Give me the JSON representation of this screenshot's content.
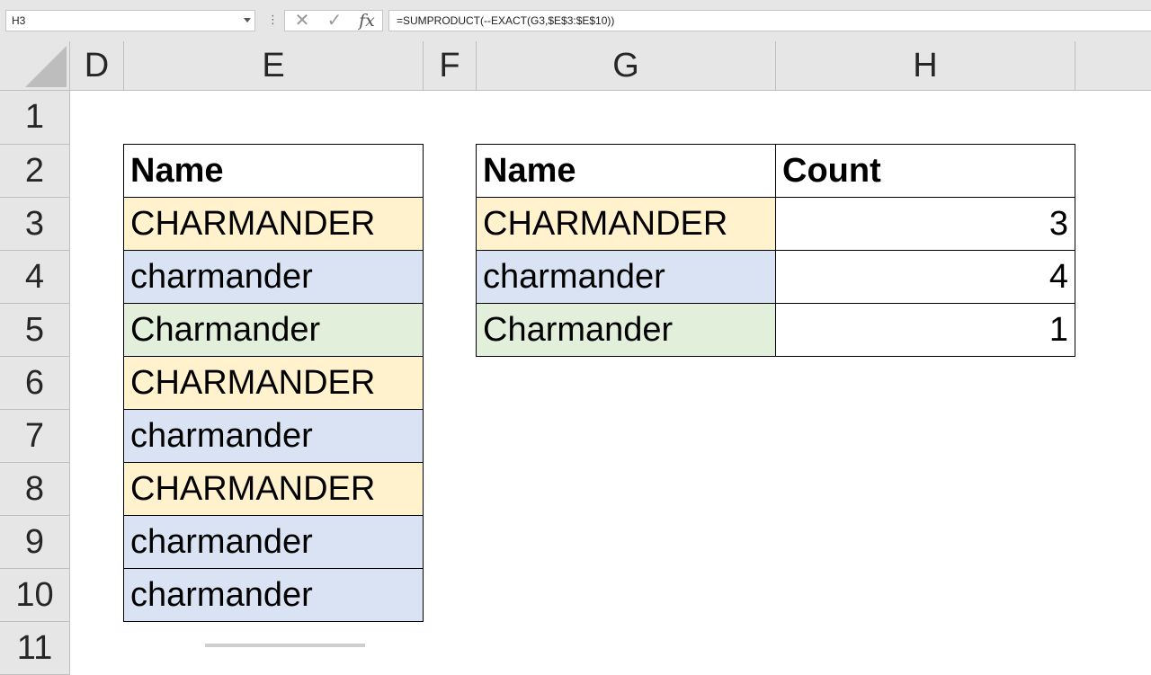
{
  "formula_bar": {
    "name_box": "H3",
    "formula": "=SUMPRODUCT(--EXACT(G3,$E$3:$E$10))",
    "cancel_icon": "close-icon",
    "enter_icon": "check-icon",
    "fx_label": "fx"
  },
  "columns": [
    "D",
    "E",
    "F",
    "G",
    "H"
  ],
  "rows": [
    "1",
    "2",
    "3",
    "4",
    "5",
    "6",
    "7",
    "8",
    "9",
    "10",
    "11"
  ],
  "colors": {
    "upper": "#fff2cc",
    "lower": "#dae3f3",
    "proper": "#e2efda"
  },
  "names_table": {
    "header": "Name",
    "values": [
      "CHARMANDER",
      "charmander",
      "Charmander",
      "CHARMANDER",
      "charmander",
      "CHARMANDER",
      "charmander",
      "charmander"
    ]
  },
  "count_table": {
    "headers": [
      "Name",
      "Count"
    ],
    "rows": [
      {
        "name": "CHARMANDER",
        "count": "3"
      },
      {
        "name": "charmander",
        "count": "4"
      },
      {
        "name": "Charmander",
        "count": "1"
      }
    ]
  }
}
